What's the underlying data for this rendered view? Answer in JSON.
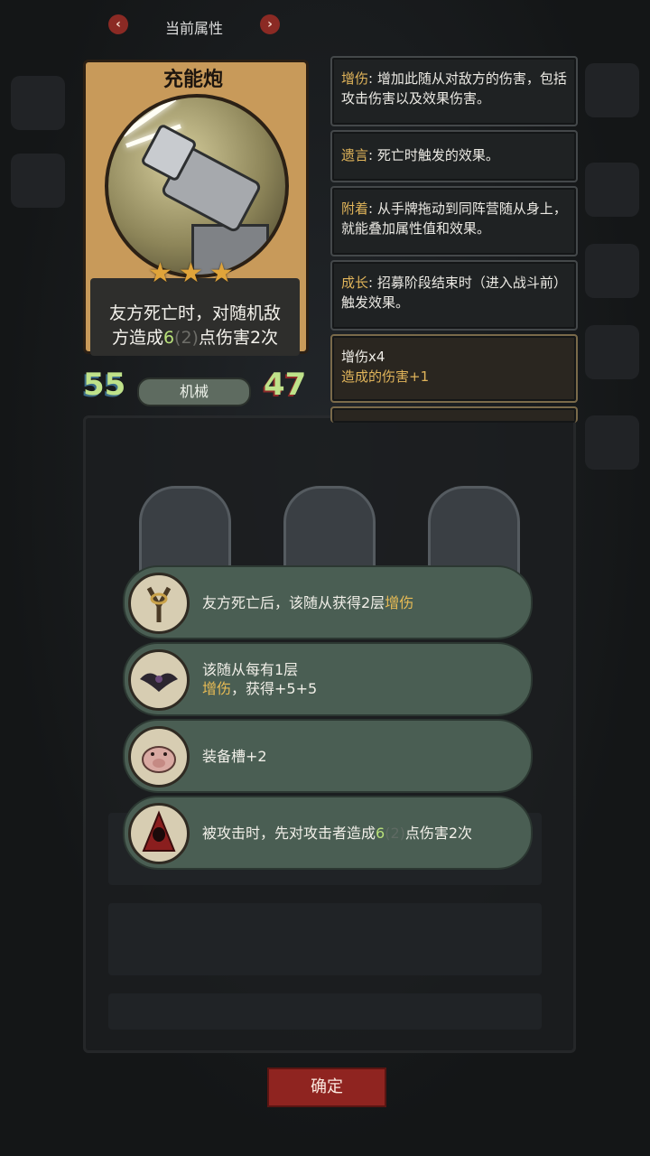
{
  "header": {
    "title": "当前属性",
    "prev": "‹",
    "next": "›"
  },
  "card": {
    "name": "充能炮",
    "stars": 3,
    "star_glyph": "★",
    "desc_line1": "友方死亡时，对随机敌",
    "desc_line2_pre": "方造成",
    "desc_value": "6",
    "desc_dim": "(2)",
    "desc_line2_post": "点伤害2次",
    "attack": "55",
    "tribe": "机械",
    "health": "47"
  },
  "info_boxes": [
    {
      "keyword": "增伤",
      "text": ": 增加此随从对敌方的伤害，包括攻击伤害以及效果伤害。"
    },
    {
      "keyword": "遗言",
      "text": ": 死亡时触发的效果。"
    },
    {
      "keyword": "附着",
      "text": ": 从手牌拖动到同阵营随从身上，就能叠加属性值和效果。"
    },
    {
      "keyword": "成长",
      "text": ": 招募阶段结束时（进入战斗前）触发效果。"
    }
  ],
  "buff_box": {
    "line1": "增伤x4",
    "line2_pre": "造成的伤害",
    "line2_value": "+1"
  },
  "perks": [
    {
      "icon": "slingshot-icon",
      "pre": "友方死亡后，该随从获得2层",
      "highlight": "增伤",
      "post": ""
    },
    {
      "icon": "bat-icon",
      "line1": "该随从每有1层",
      "highlight": "增伤",
      "post": "，获得+5+5"
    },
    {
      "icon": "pig-icon",
      "pre": "装备槽+2"
    },
    {
      "icon": "red-hood-icon",
      "pre": "被攻击时，先对攻击者造成",
      "value": "6",
      "dim": "(2)",
      "post": "点伤害2次"
    }
  ],
  "confirm_label": "确定",
  "colors": {
    "accent_gold": "#e0b45a",
    "value_green": "#b8e07a",
    "button_red": "#8f2420",
    "perk_green": "#4a5e53"
  }
}
